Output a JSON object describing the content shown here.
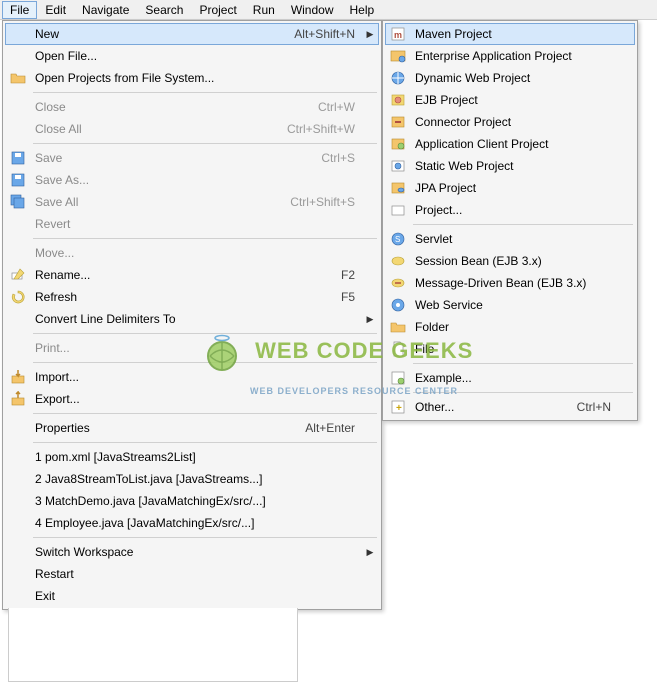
{
  "menubar": [
    "File",
    "Edit",
    "Navigate",
    "Search",
    "Project",
    "Run",
    "Window",
    "Help"
  ],
  "fileMenu": {
    "groups": [
      [
        {
          "label": "New",
          "shortcut": "Alt+Shift+N",
          "arrow": true,
          "highlight": true,
          "name": "menu-file-new"
        },
        {
          "label": "Open File...",
          "name": "menu-file-open-file"
        },
        {
          "label": "Open Projects from File System...",
          "icon": "folder",
          "name": "menu-file-open-projects"
        }
      ],
      [
        {
          "label": "Close",
          "shortcut": "Ctrl+W",
          "disabled": true,
          "name": "menu-file-close"
        },
        {
          "label": "Close All",
          "shortcut": "Ctrl+Shift+W",
          "disabled": true,
          "name": "menu-file-close-all"
        }
      ],
      [
        {
          "label": "Save",
          "shortcut": "Ctrl+S",
          "disabled": true,
          "icon": "save",
          "name": "menu-file-save"
        },
        {
          "label": "Save As...",
          "disabled": true,
          "icon": "save",
          "name": "menu-file-save-as"
        },
        {
          "label": "Save All",
          "shortcut": "Ctrl+Shift+S",
          "disabled": true,
          "icon": "saveall",
          "name": "menu-file-save-all"
        },
        {
          "label": "Revert",
          "disabled": true,
          "name": "menu-file-revert"
        }
      ],
      [
        {
          "label": "Move...",
          "disabled": true,
          "name": "menu-file-move"
        },
        {
          "label": "Rename...",
          "shortcut": "F2",
          "icon": "rename",
          "name": "menu-file-rename"
        },
        {
          "label": "Refresh",
          "shortcut": "F5",
          "icon": "refresh",
          "name": "menu-file-refresh"
        },
        {
          "label": "Convert Line Delimiters To",
          "arrow": true,
          "name": "menu-file-convert-delimiters"
        }
      ],
      [
        {
          "label": "Print...",
          "disabled": true,
          "name": "menu-file-print"
        }
      ],
      [
        {
          "label": "Import...",
          "icon": "import",
          "name": "menu-file-import"
        },
        {
          "label": "Export...",
          "icon": "export",
          "name": "menu-file-export"
        }
      ],
      [
        {
          "label": "Properties",
          "shortcut": "Alt+Enter",
          "name": "menu-file-properties"
        }
      ],
      [
        {
          "label": "1 pom.xml  [JavaStreams2List]",
          "name": "menu-file-recent-1"
        },
        {
          "label": "2 Java8StreamToList.java  [JavaStreams...]",
          "name": "menu-file-recent-2"
        },
        {
          "label": "3 MatchDemo.java  [JavaMatchingEx/src/...]",
          "name": "menu-file-recent-3"
        },
        {
          "label": "4 Employee.java  [JavaMatchingEx/src/...]",
          "name": "menu-file-recent-4"
        }
      ],
      [
        {
          "label": "Switch Workspace",
          "arrow": true,
          "name": "menu-file-switch-workspace"
        },
        {
          "label": "Restart",
          "name": "menu-file-restart"
        },
        {
          "label": "Exit",
          "name": "menu-file-exit"
        }
      ]
    ]
  },
  "newMenu": {
    "groups": [
      [
        {
          "label": "Maven Project",
          "icon": "maven",
          "highlight": true,
          "name": "menu-new-maven-project"
        },
        {
          "label": "Enterprise Application Project",
          "icon": "ear",
          "name": "menu-new-ear-project"
        },
        {
          "label": "Dynamic Web Project",
          "icon": "dynweb",
          "name": "menu-new-dynamic-web-project"
        },
        {
          "label": "EJB Project",
          "icon": "ejb",
          "name": "menu-new-ejb-project"
        },
        {
          "label": "Connector Project",
          "icon": "connector",
          "name": "menu-new-connector-project"
        },
        {
          "label": "Application Client Project",
          "icon": "appclient",
          "name": "menu-new-app-client-project"
        },
        {
          "label": "Static Web Project",
          "icon": "staticweb",
          "name": "menu-new-static-web-project"
        },
        {
          "label": "JPA Project",
          "icon": "jpa",
          "name": "menu-new-jpa-project"
        },
        {
          "label": "Project...",
          "icon": "project",
          "name": "menu-new-project"
        }
      ],
      [
        {
          "label": "Servlet",
          "icon": "servlet",
          "name": "menu-new-servlet"
        },
        {
          "label": "Session Bean (EJB 3.x)",
          "icon": "sessionbean",
          "name": "menu-new-session-bean"
        },
        {
          "label": "Message-Driven Bean (EJB 3.x)",
          "icon": "mdbean",
          "name": "menu-new-mdb"
        },
        {
          "label": "Web Service",
          "icon": "webservice",
          "name": "menu-new-web-service"
        },
        {
          "label": "Folder",
          "icon": "folder",
          "name": "menu-new-folder"
        },
        {
          "label": "File",
          "icon": "file",
          "name": "menu-new-file"
        }
      ],
      [
        {
          "label": "Example...",
          "icon": "example",
          "name": "menu-new-example"
        }
      ],
      [
        {
          "label": "Other...",
          "shortcut": "Ctrl+N",
          "icon": "other",
          "name": "menu-new-other"
        }
      ]
    ]
  },
  "watermark": {
    "title": "WEB CODE GEEKS",
    "subtitle": "WEB DEVELOPERS RESOURCE CENTER"
  }
}
